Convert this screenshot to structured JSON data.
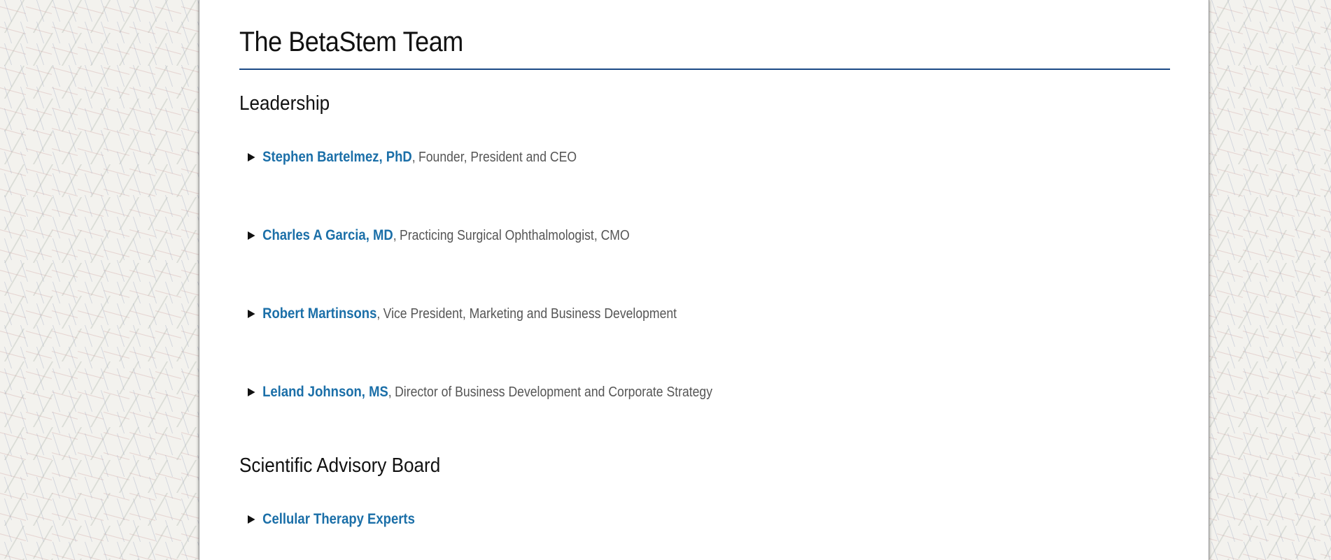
{
  "page": {
    "title": "The BetaStem Team"
  },
  "leadership": {
    "heading": "Leadership",
    "members": [
      {
        "name": "Stephen Bartelmez, PhD",
        "role": "Founder, President and CEO"
      },
      {
        "name": "Charles A Garcia, MD",
        "role": "Practicing Surgical Ophthalmologist, CMO"
      },
      {
        "name": "Robert Martinsons",
        "role": "Vice President, Marketing and Business Development"
      },
      {
        "name": "Leland Johnson, MS",
        "role": "Director of Business Development and Corporate Strategy"
      }
    ],
    "separator": ","
  },
  "advisory": {
    "heading": "Scientific Advisory Board",
    "groups": [
      {
        "label": "Cellular Therapy Experts"
      }
    ]
  },
  "colors": {
    "link": "#1b6fa8",
    "rule": "#1c4a86",
    "text": "#111111",
    "role_text": "#555555"
  },
  "icons": {
    "expand": "triangle-right-icon"
  }
}
